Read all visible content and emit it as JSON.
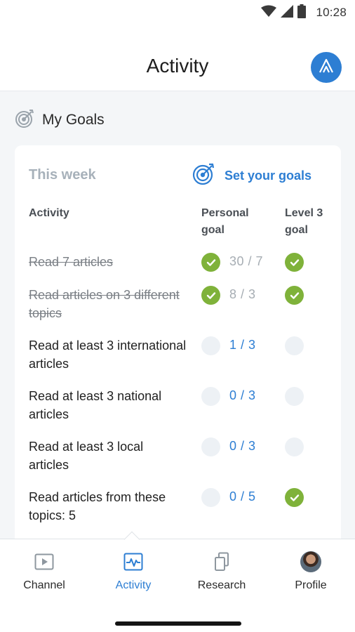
{
  "status_bar": {
    "time": "10:28"
  },
  "header": {
    "title": "Activity",
    "avatar_icon": "app-logo-icon"
  },
  "section": {
    "title": "My Goals",
    "icon": "target-icon"
  },
  "card": {
    "week_label": "This week",
    "set_goals_label": "Set your goals",
    "columns": {
      "activity": "Activity",
      "personal": "Personal goal",
      "level": "Level 3 goal"
    },
    "goals": [
      {
        "text": "Read 7 articles",
        "progress": "30 / 7",
        "personal_done": true,
        "level_done": true,
        "completed": true
      },
      {
        "text": "Read articles on 3 different topics",
        "progress": "8 / 3",
        "personal_done": true,
        "level_done": true,
        "completed": true
      },
      {
        "text": "Read at least 3 international articles",
        "progress": "1 / 3",
        "personal_done": false,
        "level_done": false,
        "completed": false
      },
      {
        "text": "Read at least 3 national articles",
        "progress": "0 / 3",
        "personal_done": false,
        "level_done": false,
        "completed": false
      },
      {
        "text": "Read at least 3 local articles",
        "progress": "0 / 3",
        "personal_done": false,
        "level_done": false,
        "completed": false
      },
      {
        "text": "Read articles from these topics: 5",
        "progress": "0 / 5",
        "personal_done": false,
        "level_done": true,
        "completed": false
      }
    ]
  },
  "bottom_nav": {
    "items": [
      {
        "label": "Channel",
        "icon": "play-icon",
        "active": false
      },
      {
        "label": "Activity",
        "icon": "activity-pulse-icon",
        "active": true
      },
      {
        "label": "Research",
        "icon": "documents-icon",
        "active": false
      },
      {
        "label": "Profile",
        "icon": "profile-photo",
        "active": false
      }
    ]
  },
  "colors": {
    "accent": "#2d7ed3",
    "success": "#7fb23a",
    "pending": "#edf1f5",
    "muted": "#a7b1ba"
  }
}
